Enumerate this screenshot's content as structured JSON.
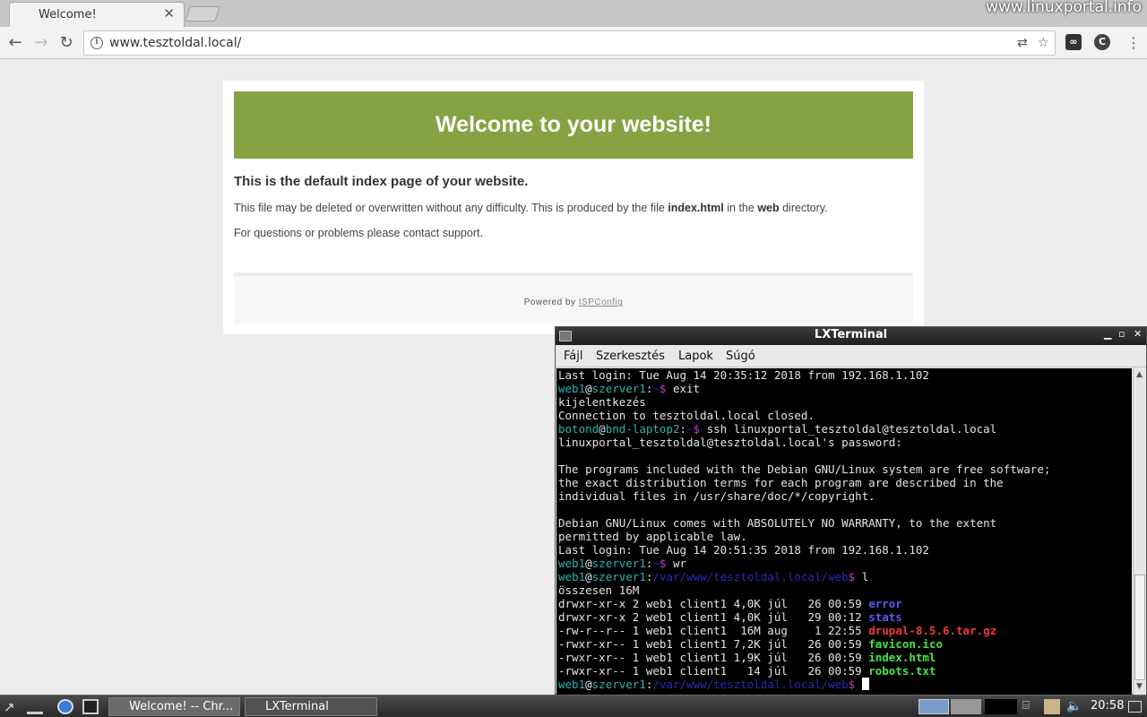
{
  "browser": {
    "tab_title": "Welcome!",
    "url": "www.tesztoldal.local/",
    "watermark": "www.linuxportal.info"
  },
  "webpage": {
    "banner": "Welcome to your website!",
    "heading": "This is the default index page of your website.",
    "para1_pre": "This file may be deleted or overwritten without any difficulty. This is produced by the file ",
    "para1_file": "index.html",
    "para1_mid": " in the ",
    "para1_dir": "web",
    "para1_post": " directory.",
    "para2": "For questions or problems please contact support.",
    "footer_pre": "Powered by ",
    "footer_link": "ISPConfig"
  },
  "terminal": {
    "title": "LXTerminal",
    "menu": [
      "Fájl",
      "Szerkesztés",
      "Lapok",
      "Súgó"
    ],
    "lines": [
      [
        {
          "t": "Last login: Tue Aug 14 20:35:12 2018 from 192.168.1.102"
        }
      ],
      [
        {
          "t": "web1",
          "c": "user"
        },
        {
          "t": "@",
          "c": "at"
        },
        {
          "t": "szerver1",
          "c": "user"
        },
        {
          "t": ":",
          "c": "at"
        },
        {
          "t": "~",
          "c": "path"
        },
        {
          "t": "$",
          "c": "dollar"
        },
        {
          "t": " exit"
        }
      ],
      [
        {
          "t": "kijelentkezés"
        }
      ],
      [
        {
          "t": "Connection to tesztoldal.local closed."
        }
      ],
      [
        {
          "t": "botond",
          "c": "user"
        },
        {
          "t": "@",
          "c": "at"
        },
        {
          "t": "bnd-laptop2",
          "c": "user"
        },
        {
          "t": ":",
          "c": "at"
        },
        {
          "t": "~",
          "c": "path"
        },
        {
          "t": "$",
          "c": "dollar"
        },
        {
          "t": " ssh linuxportal_tesztoldal@tesztoldal.local"
        }
      ],
      [
        {
          "t": "linuxportal_tesztoldal@tesztoldal.local's password:"
        }
      ],
      [
        {
          "t": ""
        }
      ],
      [
        {
          "t": "The programs included with the Debian GNU/Linux system are free software;"
        }
      ],
      [
        {
          "t": "the exact distribution terms for each program are described in the"
        }
      ],
      [
        {
          "t": "individual files in /usr/share/doc/*/copyright."
        }
      ],
      [
        {
          "t": ""
        }
      ],
      [
        {
          "t": "Debian GNU/Linux comes with ABSOLUTELY NO WARRANTY, to the extent"
        }
      ],
      [
        {
          "t": "permitted by applicable law."
        }
      ],
      [
        {
          "t": "Last login: Tue Aug 14 20:51:35 2018 from 192.168.1.102"
        }
      ],
      [
        {
          "t": "web1",
          "c": "user"
        },
        {
          "t": "@",
          "c": "at"
        },
        {
          "t": "szerver1",
          "c": "user"
        },
        {
          "t": ":",
          "c": "at"
        },
        {
          "t": "~",
          "c": "path"
        },
        {
          "t": "$",
          "c": "dollar"
        },
        {
          "t": " wr"
        }
      ],
      [
        {
          "t": "web1",
          "c": "user"
        },
        {
          "t": "@",
          "c": "at"
        },
        {
          "t": "szerver1",
          "c": "user"
        },
        {
          "t": ":",
          "c": "at"
        },
        {
          "t": "/var/www/tesztoldal.local/web",
          "c": "path"
        },
        {
          "t": "$",
          "c": "dollar"
        },
        {
          "t": " l"
        }
      ],
      [
        {
          "t": "összesen 16M"
        }
      ],
      [
        {
          "t": "drwxr-xr-x 2 web1 client1 4,0K júl   26 00:59 "
        },
        {
          "t": "error",
          "c": "dir"
        }
      ],
      [
        {
          "t": "drwxr-xr-x 2 web1 client1 4,0K júl   29 00:12 "
        },
        {
          "t": "stats",
          "c": "dir"
        }
      ],
      [
        {
          "t": "-rw-r--r-- 1 web1 client1  16M aug    1 22:55 "
        },
        {
          "t": "drupal-8.5.6.tar.gz",
          "c": "arch"
        }
      ],
      [
        {
          "t": "-rwxr-xr-- 1 web1 client1 7,2K júl   26 00:59 "
        },
        {
          "t": "favicon.ico",
          "c": "exec"
        }
      ],
      [
        {
          "t": "-rwxr-xr-- 1 web1 client1 1,9K júl   26 00:59 "
        },
        {
          "t": "index.html",
          "c": "exec"
        }
      ],
      [
        {
          "t": "-rwxr-xr-- 1 web1 client1   14 júl   26 00:59 "
        },
        {
          "t": "robots.txt",
          "c": "exec"
        }
      ],
      [
        {
          "t": "web1",
          "c": "user"
        },
        {
          "t": "@",
          "c": "at"
        },
        {
          "t": "szerver1",
          "c": "user"
        },
        {
          "t": ":",
          "c": "at"
        },
        {
          "t": "/var/www/tesztoldal.local/web",
          "c": "path"
        },
        {
          "t": "$",
          "c": "dollar"
        },
        {
          "t": " "
        },
        {
          "t": "",
          "c": "cursor"
        }
      ]
    ]
  },
  "taskbar": {
    "tasks": [
      "Welcome! -- Chr...",
      "LXTerminal"
    ],
    "clock": "20:58"
  }
}
